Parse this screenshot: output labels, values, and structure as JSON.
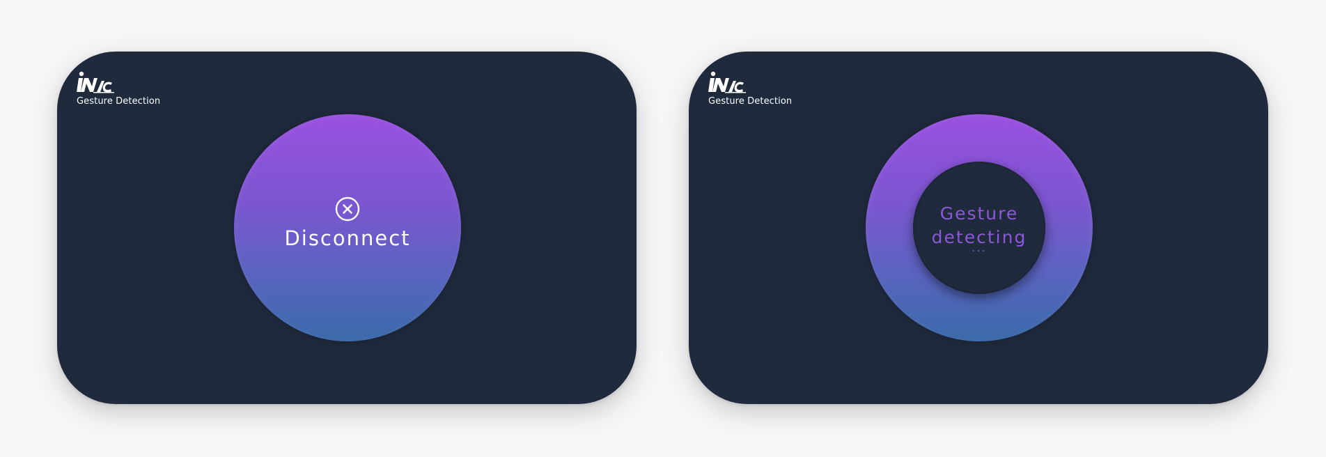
{
  "screens": [
    {
      "brand": {
        "subtitle": "Gesture Detection"
      },
      "button": {
        "icon": "close-circle-icon",
        "label": "Disconnect"
      }
    },
    {
      "brand": {
        "subtitle": "Gesture Detection"
      },
      "status": {
        "line1": "Gesture",
        "line2": "detecting",
        "dots": "..."
      }
    }
  ],
  "colors": {
    "background": "#f6f6f7",
    "card": "#1f2a3d",
    "gradient_top": "#994fe0",
    "gradient_bottom": "#3b6aaa",
    "detecting_text": "#8c58d6"
  }
}
